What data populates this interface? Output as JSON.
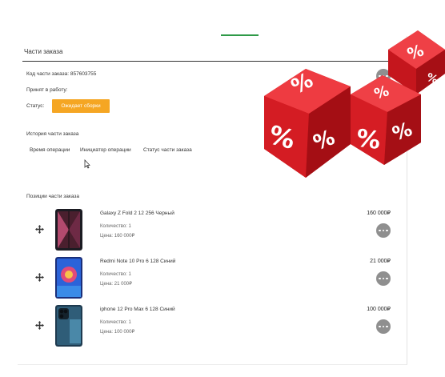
{
  "panel": {
    "title": "Части заказа",
    "code_label": "Код части заказа: 857603755",
    "accepted_label": "Принят в работу:",
    "status_label": "Статус:",
    "status_badge": "Ожидает сборки"
  },
  "history": {
    "title": "История части заказа",
    "columns": [
      "Время операции",
      "Инициатор операции",
      "Статус части заказа"
    ]
  },
  "positions": {
    "title": "Позиции части заказа",
    "items": [
      {
        "name": "Galaxy Z Fold 2 12 256 Черный",
        "qty": "Количество:  1",
        "price": "Цена:  160 000₽",
        "total": "160 000₽"
      },
      {
        "name": "Redmi Note 10 Pro 6 128 Синий",
        "qty": "Количество:  1",
        "price": "Цена:  21 000₽",
        "total": "21 000₽"
      },
      {
        "name": "iphone 12 Pro Max 6 128 Синий",
        "qty": "Количество:  1",
        "price": "Цена:  100 000₽",
        "total": "100 000₽"
      }
    ]
  },
  "icons": [
    "more-icon",
    "drag-handle-icon",
    "cursor-icon",
    "percent-dice-icon"
  ],
  "colors": {
    "status_badge": "#f5a623",
    "accent_tab": "#2f9a48",
    "dice_red": "#d81f26"
  }
}
